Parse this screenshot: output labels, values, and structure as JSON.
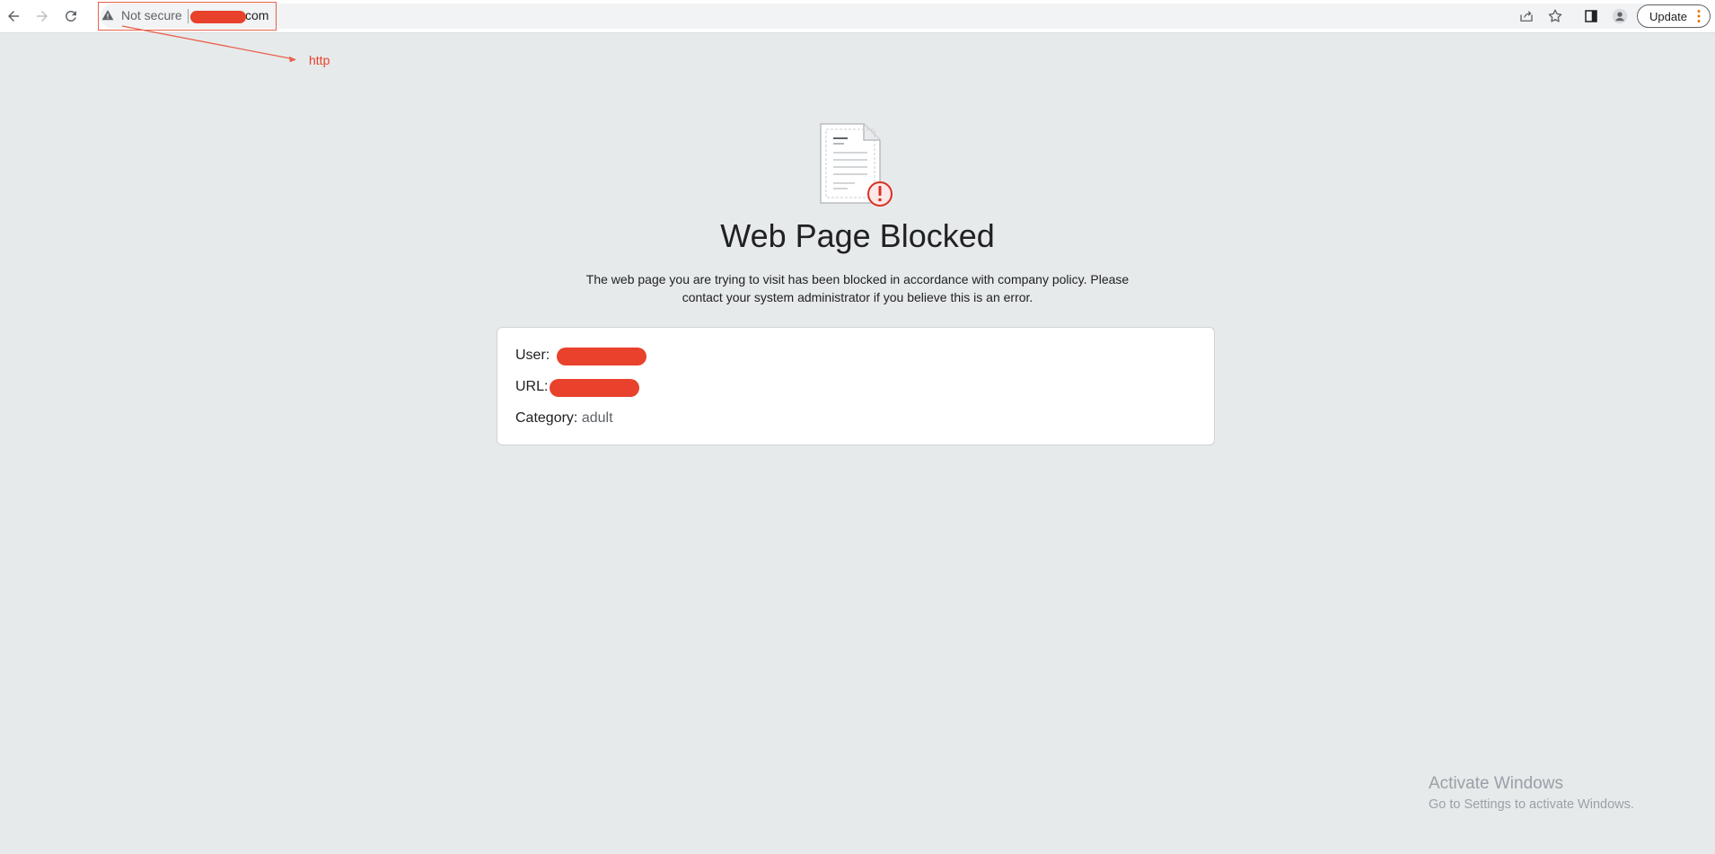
{
  "toolbar": {
    "back_icon": "arrow-left-icon",
    "forward_icon": "arrow-right-icon",
    "reload_icon": "reload-icon",
    "security_label": "Not secure",
    "url_suffix": "com",
    "share_icon": "share-icon",
    "bookmark_icon": "star-icon",
    "side_panel_icon": "side-panel-icon",
    "profile_icon": "profile-icon",
    "update_label": "Update",
    "menu_icon": "more-vert-icon"
  },
  "annotation": {
    "label": "http",
    "color": "#e8412c"
  },
  "page": {
    "icon": "document-warning-icon",
    "title": "Web Page Blocked",
    "description": "The web page you are trying to visit has been blocked in accordance with company policy. Please contact your system administrator if you believe this is an error.",
    "info": {
      "user_label": "User:",
      "url_label": "URL:",
      "category_label": "Category:",
      "category_value": "adult"
    }
  },
  "watermark": {
    "title": "Activate Windows",
    "subtitle": "Go to Settings to activate Windows."
  },
  "colors": {
    "page_background": "#e7eaeb",
    "redaction": "#e8412c",
    "alert": "#d93025"
  }
}
